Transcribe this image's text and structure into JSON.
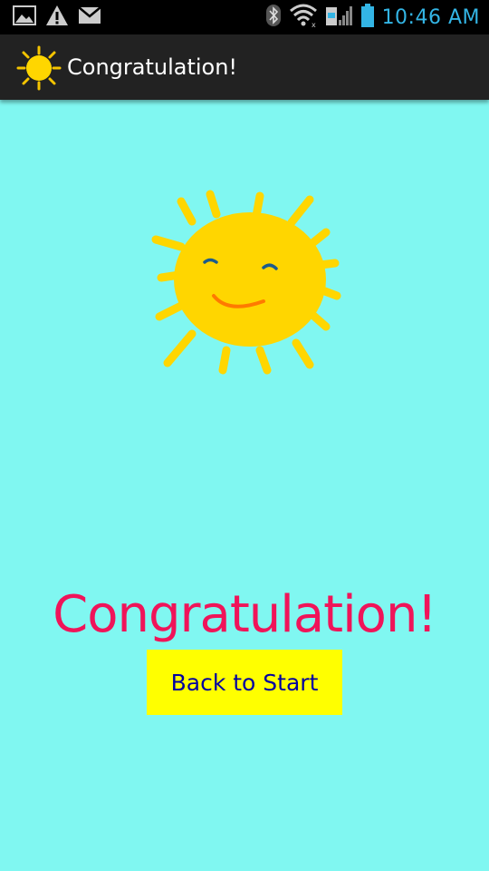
{
  "status_bar": {
    "time": "10:46 AM",
    "left_icons": [
      "gallery-icon",
      "warning-icon",
      "gmail-icon"
    ],
    "right_icons": [
      "bluetooth-icon",
      "wifi-icon",
      "signal-icon",
      "battery-icon"
    ],
    "accent_color": "#33b5e5"
  },
  "action_bar": {
    "title": "Congratulation!",
    "app_icon": "sun-icon"
  },
  "main": {
    "illustration": "smiling-sun-drawing",
    "message": "Congratulation!",
    "back_button_label": "Back to Start",
    "colors": {
      "background": "#80f7f1",
      "message": "#f01459",
      "button_bg": "#ffff00",
      "button_text": "#0000a0"
    }
  }
}
